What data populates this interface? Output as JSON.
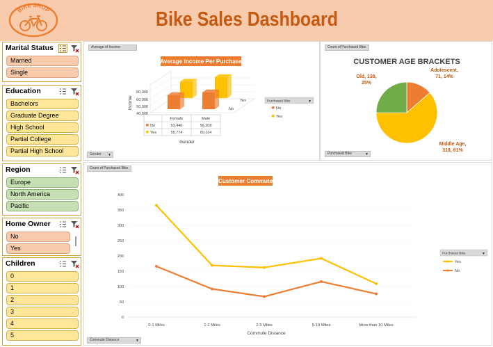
{
  "header": {
    "title": "Bike Sales Dashboard",
    "logo_text": "BIKE SHOP"
  },
  "slicers": [
    {
      "title": "Marital Status",
      "items": [
        "Married",
        "Single"
      ]
    },
    {
      "title": "Education",
      "items": [
        "Bachelors",
        "Graduate Degree",
        "High School",
        "Partial College",
        "Partial High School"
      ]
    },
    {
      "title": "Region",
      "items": [
        "Europe",
        "North America",
        "Pacific"
      ]
    },
    {
      "title": "Home Owner",
      "items": [
        "No",
        "Yes"
      ]
    },
    {
      "title": "Children",
      "items": [
        "0",
        "1",
        "2",
        "3",
        "4",
        "5"
      ]
    }
  ],
  "income_panel": {
    "field_top": "Average of Income",
    "field_bottom": "Gender",
    "legend_field": "Purchased Bike"
  },
  "age_panel": {
    "field_top": "Count of Purchased Bike",
    "field_bottom": "Purchased Bike"
  },
  "commute_panel": {
    "field_top": "Count of Purchased Bike",
    "field_bottom": "Commute Distance",
    "legend_field": "Purchased Bike"
  },
  "colors": {
    "header_bg": "#f8cbad",
    "title": "#c65911",
    "orange": "#ed7d31",
    "gold": "#ffc000",
    "green": "#70ad47"
  },
  "chart_data": [
    {
      "type": "bar",
      "title": "Average Income Per Purchase",
      "xlabel": "Gender",
      "ylabel": "Income",
      "categories": [
        "Female",
        "Male"
      ],
      "series": [
        {
          "name": "No",
          "values": [
            53440,
            56208
          ]
        },
        {
          "name": "Yes",
          "values": [
            55774,
            60124
          ]
        }
      ],
      "value_labels": {
        "No": [
          "53,440",
          "56,208"
        ],
        "Yes": [
          "55,774",
          "60,124"
        ]
      },
      "depth_labels": [
        "No",
        "Yes"
      ],
      "y_ticks": [
        "40,000",
        "50,000",
        "60,000",
        "80,000"
      ],
      "ylim": [
        40000,
        80000
      ],
      "legend_title": "Purchased Bike",
      "legend_position": "right"
    },
    {
      "type": "pie",
      "title": "CUSTOMER AGE BRACKETS",
      "slices": [
        {
          "name": "Adolescent",
          "value": 71,
          "percent": 14
        },
        {
          "name": "Middle Age",
          "value": 318,
          "percent": 61
        },
        {
          "name": "Old",
          "value": 130,
          "percent": 25
        }
      ],
      "labels": [
        [
          "Adolescent,",
          "71, 14%"
        ],
        [
          "Middle Age,",
          "318, 61%"
        ],
        [
          "Old, 130,",
          "25%"
        ]
      ]
    },
    {
      "type": "line",
      "title": "Customer Commute",
      "xlabel": "Commute Distance",
      "categories": [
        "0-1 Miles",
        "1-2 Miles",
        "2-5 Miles",
        "5-10 Miles",
        "More than 10 Miles"
      ],
      "series": [
        {
          "name": "Yes",
          "values": [
            365,
            169,
            162,
            192,
            109
          ]
        },
        {
          "name": "No",
          "values": [
            166,
            92,
            67,
            116,
            76
          ]
        }
      ],
      "y_ticks": [
        "0",
        "50",
        "100",
        "150",
        "200",
        "250",
        "300",
        "350",
        "400"
      ],
      "ylim": [
        0,
        400
      ],
      "legend_title": "Purchased Bike",
      "legend_position": "right"
    }
  ]
}
